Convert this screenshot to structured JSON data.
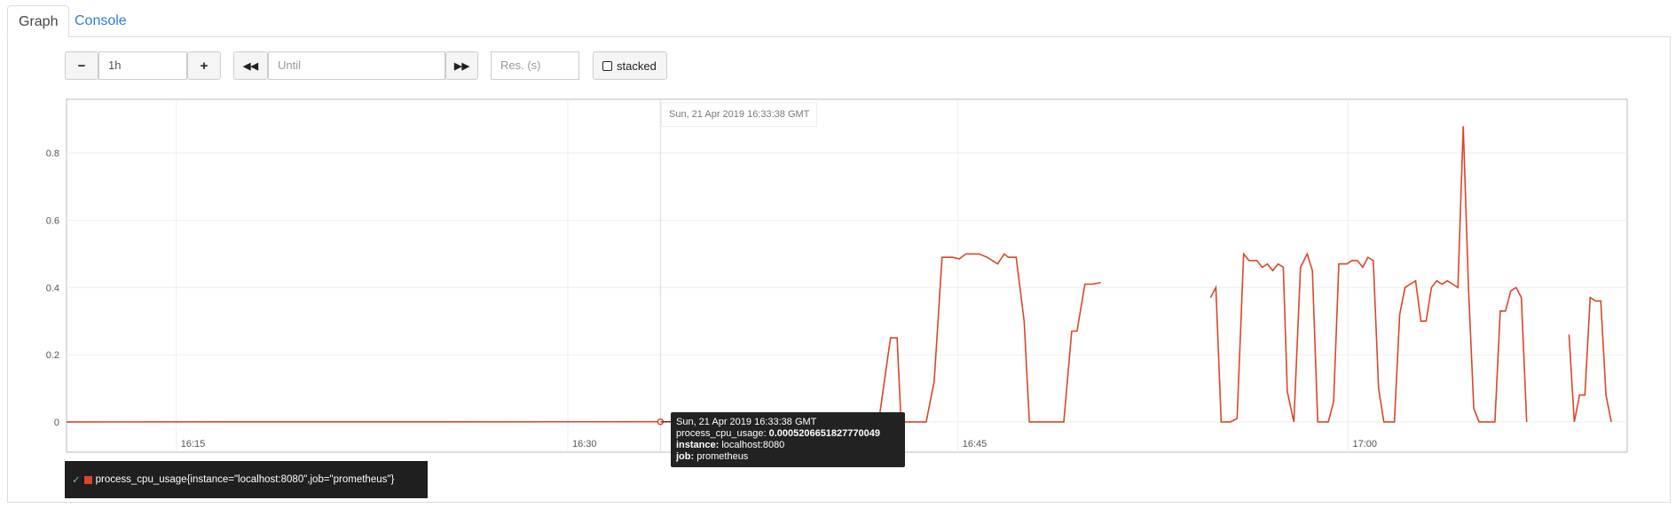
{
  "tabs": [
    {
      "label": "Graph",
      "active": true
    },
    {
      "label": "Console",
      "active": false
    }
  ],
  "controls": {
    "range_minus": "−",
    "range_value": "1h",
    "range_plus": "+",
    "back_icon": "◀◀",
    "until_placeholder": "Until",
    "forward_icon": "▶▶",
    "res_placeholder": "Res. (s)",
    "stacked_label": "stacked"
  },
  "hover_label": "Sun, 21 Apr 2019 16:33:38 GMT",
  "tooltip": {
    "time": "Sun, 21 Apr 2019 16:33:38 GMT",
    "metric_key": "process_cpu_usage: ",
    "metric_value": "0.0005206651827770049",
    "instance_label": "instance: ",
    "instance_value": "localhost:8080",
    "job_label": "job: ",
    "job_value": "prometheus"
  },
  "legend": {
    "label": "process_cpu_usage{instance=\"localhost:8080\",job=\"prometheus\"}",
    "color": "#d8472b"
  },
  "chart_data": {
    "type": "line",
    "y_ticks": [
      "0",
      "0.2",
      "0.4",
      "0.6",
      "0.8"
    ],
    "x_ticks": [
      "16:15",
      "16:30",
      "16:45",
      "17:00"
    ],
    "ylim": [
      -0.09,
      0.96
    ],
    "series": [
      {
        "name": "process_cpu_usage{instance=\"localhost:8080\",job=\"prometheus\"}",
        "color": "#d8472b",
        "segments": [
          [
            [
              0,
              0
            ],
            [
              46.8,
              0.0005
            ],
            [
              60.6,
              0
            ],
            [
              61.4,
              0.0
            ],
            [
              62.3,
              0.25
            ],
            [
              62.8,
              0.25
            ],
            [
              63.1,
              0
            ],
            [
              65,
              0
            ],
            [
              65.6,
              0.12
            ],
            [
              66.2,
              0.49
            ],
            [
              67,
              0.49
            ],
            [
              67.5,
              0.485
            ],
            [
              68,
              0.5
            ],
            [
              69,
              0.5
            ],
            [
              69.6,
              0.49
            ],
            [
              70.4,
              0.47
            ],
            [
              70.9,
              0.5
            ],
            [
              71.2,
              0.49
            ],
            [
              71.8,
              0.49
            ],
            [
              72.4,
              0.3
            ],
            [
              72.8,
              0
            ],
            [
              74,
              0
            ],
            [
              75,
              0
            ],
            [
              75.4,
              0
            ],
            [
              76,
              0.27
            ],
            [
              76.4,
              0.27
            ],
            [
              77,
              0.41
            ],
            [
              77.6,
              0.41
            ],
            [
              78.2,
              0.415
            ]
          ],
          [
            [
              86.5,
              0.37
            ],
            [
              86.9,
              0.4
            ],
            [
              87.3,
              0
            ],
            [
              88,
              0
            ],
            [
              88.5,
              0.01
            ],
            [
              89,
              0.5
            ],
            [
              89.4,
              0.48
            ],
            [
              90,
              0.48
            ],
            [
              90.4,
              0.46
            ],
            [
              90.8,
              0.47
            ],
            [
              91.2,
              0.45
            ],
            [
              91.6,
              0.47
            ],
            [
              92,
              0.46
            ],
            [
              92.3,
              0.09
            ],
            [
              92.8,
              0
            ],
            [
              93.3,
              0.46
            ],
            [
              93.8,
              0.5
            ],
            [
              94.2,
              0.45
            ],
            [
              94.6,
              0
            ],
            [
              95.4,
              0
            ],
            [
              95.8,
              0.06
            ],
            [
              96.2,
              0.47
            ],
            [
              96.8,
              0.47
            ],
            [
              97.2,
              0.48
            ],
            [
              97.6,
              0.48
            ],
            [
              98,
              0.46
            ],
            [
              98.4,
              0.49
            ],
            [
              98.8,
              0.48
            ],
            [
              99.2,
              0.1
            ],
            [
              99.6,
              0
            ],
            [
              100.4,
              0
            ],
            [
              100.8,
              0.32
            ],
            [
              101.2,
              0.4
            ],
            [
              101.6,
              0.41
            ],
            [
              102,
              0.42
            ],
            [
              102.4,
              0.3
            ],
            [
              102.8,
              0.3
            ],
            [
              103.2,
              0.4
            ],
            [
              103.6,
              0.42
            ],
            [
              104,
              0.41
            ],
            [
              104.4,
              0.42
            ],
            [
              104.8,
              0.41
            ],
            [
              105.2,
              0.4
            ],
            [
              105.6,
              0.88
            ],
            [
              106,
              0.4
            ],
            [
              106.4,
              0.04
            ],
            [
              106.8,
              0
            ],
            [
              108,
              0
            ],
            [
              108.4,
              0.33
            ],
            [
              108.8,
              0.33
            ],
            [
              109.2,
              0.39
            ],
            [
              109.6,
              0.4
            ],
            [
              110,
              0.37
            ],
            [
              110.4,
              0
            ]
          ],
          [
            [
              113.6,
              0.26
            ],
            [
              114,
              0
            ],
            [
              114.4,
              0.08
            ],
            [
              114.8,
              0.08
            ],
            [
              115.2,
              0.37
            ],
            [
              115.6,
              0.36
            ],
            [
              116,
              0.36
            ],
            [
              116.4,
              0.08
            ],
            [
              116.8,
              0
            ]
          ]
        ]
      }
    ]
  }
}
